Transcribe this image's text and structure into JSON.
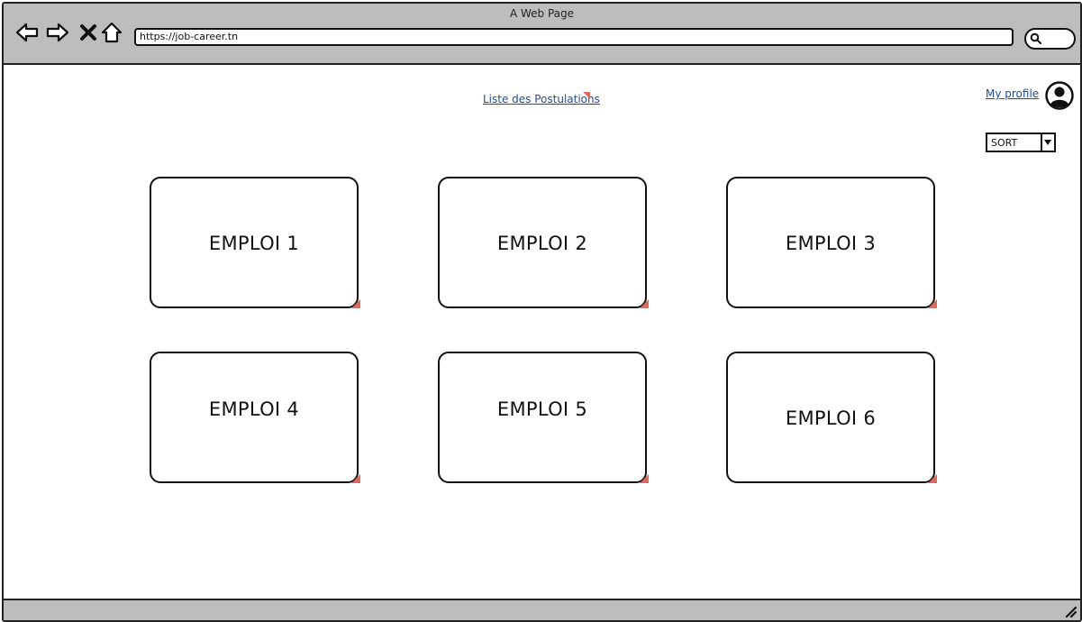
{
  "window": {
    "title": "A Web Page"
  },
  "browser": {
    "url": "https://job-career.tn",
    "icons": [
      "back-arrow-icon",
      "forward-arrow-icon",
      "close-icon",
      "home-icon",
      "search-icon"
    ]
  },
  "header": {
    "postulations_link": "Liste des Postulations",
    "profile_link": "My profile",
    "avatar_icon": "user-avatar-icon"
  },
  "sort": {
    "selected": "SORT"
  },
  "jobs": [
    {
      "title": "EMPLOI 1"
    },
    {
      "title": "EMPLOI 2"
    },
    {
      "title": "EMPLOI 3"
    },
    {
      "title": "EMPLOI 4"
    },
    {
      "title": "EMPLOI 5"
    },
    {
      "title": "EMPLOI 6"
    }
  ],
  "colors": {
    "chrome": "#bdbdbd",
    "link": "#1f4b99",
    "marker": "#d66a5e",
    "stroke": "#111111"
  }
}
